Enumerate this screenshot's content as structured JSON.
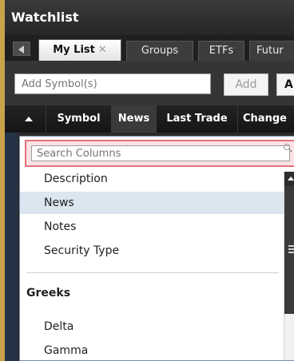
{
  "window": {
    "title": "Watchlist"
  },
  "tabs": [
    {
      "label": "My List",
      "active": true,
      "closable": true
    },
    {
      "label": "Groups",
      "active": false
    },
    {
      "label": "ETFs",
      "active": false
    },
    {
      "label": "Futur",
      "active": false
    }
  ],
  "toolbar": {
    "symbol_placeholder": "Add Symbol(s)",
    "add_label": "Add",
    "next_label": "A"
  },
  "columns": [
    {
      "label": "Symbol"
    },
    {
      "label": "News"
    },
    {
      "label": "Last Trade"
    },
    {
      "label": "Change"
    }
  ],
  "column_picker": {
    "search_placeholder": "Search Columns",
    "items": [
      {
        "label": "Description",
        "selected": false
      },
      {
        "label": "News",
        "selected": true
      },
      {
        "label": "Notes",
        "selected": false
      },
      {
        "label": "Security Type",
        "selected": false
      }
    ],
    "sections": [
      {
        "title": "Greeks",
        "items": [
          {
            "label": "Delta"
          },
          {
            "label": "Gamma"
          }
        ]
      }
    ]
  },
  "icons": {
    "nav_back": "left-arrow-icon",
    "tab_close": "close-icon",
    "sort": "sort-up-icon",
    "search": "search-icon",
    "scroll_up": "scroll-up-icon"
  },
  "colors": {
    "accent_border": "#c9a34a",
    "selected_row": "#dce6f1",
    "search_highlight": "#e5727a"
  }
}
